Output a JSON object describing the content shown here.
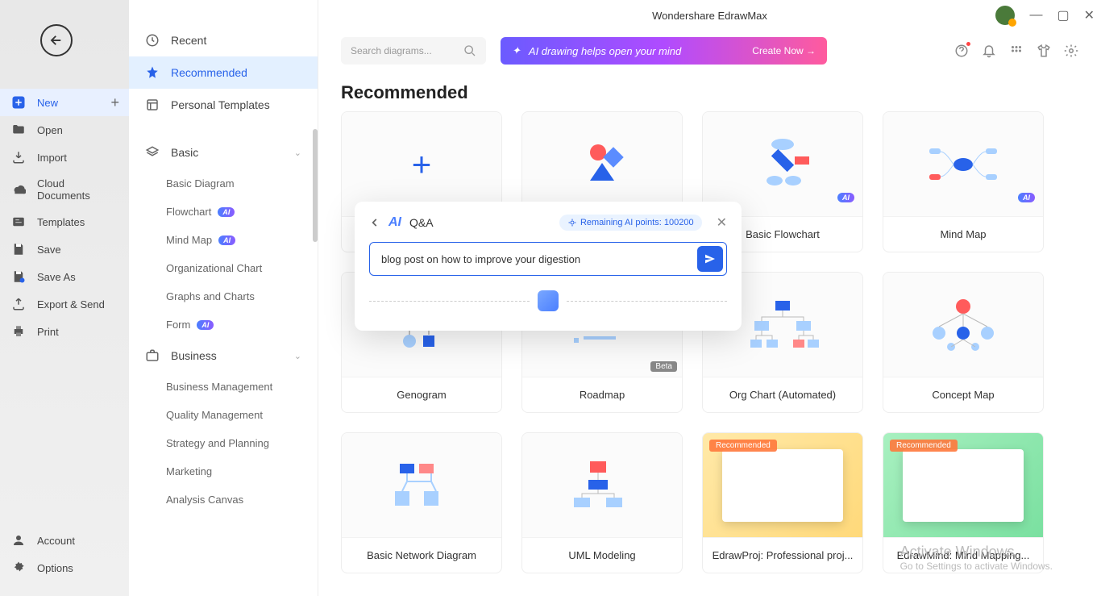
{
  "app": {
    "title": "Wondershare EdrawMax"
  },
  "sidebar_left": {
    "new": "New",
    "open": "Open",
    "import": "Import",
    "cloud_documents": "Cloud Documents",
    "templates": "Templates",
    "save": "Save",
    "save_as": "Save As",
    "export_send": "Export & Send",
    "print": "Print",
    "account": "Account",
    "options": "Options"
  },
  "sidebar_mid": {
    "recent": "Recent",
    "recommended": "Recommended",
    "personal_templates": "Personal Templates",
    "basic": {
      "header": "Basic",
      "items": [
        "Basic Diagram",
        "Flowchart",
        "Mind Map",
        "Organizational Chart",
        "Graphs and Charts",
        "Form"
      ],
      "ai_badges": [
        "",
        "AI",
        "AI",
        "",
        "",
        "AI"
      ]
    },
    "business": {
      "header": "Business",
      "items": [
        "Business Management",
        "Quality Management",
        "Strategy and Planning",
        "Marketing",
        "Analysis Canvas"
      ]
    }
  },
  "toolbar": {
    "search_placeholder": "Search diagrams...",
    "ai_banner_text": "AI drawing helps open your mind",
    "create_now": "Create Now →"
  },
  "main": {
    "section_title": "Recommended",
    "cards": [
      {
        "label": "",
        "type": "plus"
      },
      {
        "label": "",
        "type": "shapes"
      },
      {
        "label": "Basic Flowchart",
        "ai": true
      },
      {
        "label": "Mind Map",
        "ai": true
      },
      {
        "label": "Genogram"
      },
      {
        "label": "Roadmap",
        "beta": "Beta"
      },
      {
        "label": "Org Chart (Automated)"
      },
      {
        "label": "Concept Map"
      },
      {
        "label": "Basic Network Diagram"
      },
      {
        "label": "UML Modeling"
      },
      {
        "label": "EdrawProj: Professional proj...",
        "rec": "Recommended",
        "variant": "yellow"
      },
      {
        "label": "EdrawMind: Mind Mapping...",
        "rec": "Recommended",
        "variant": "green"
      }
    ]
  },
  "ai_dialog": {
    "title": "Q&A",
    "points_label": "Remaining AI points: 100200",
    "input_value": "blog post on how to improve your digestion"
  },
  "watermark": {
    "line1": "Activate Windows",
    "line2": "Go to Settings to activate Windows."
  }
}
